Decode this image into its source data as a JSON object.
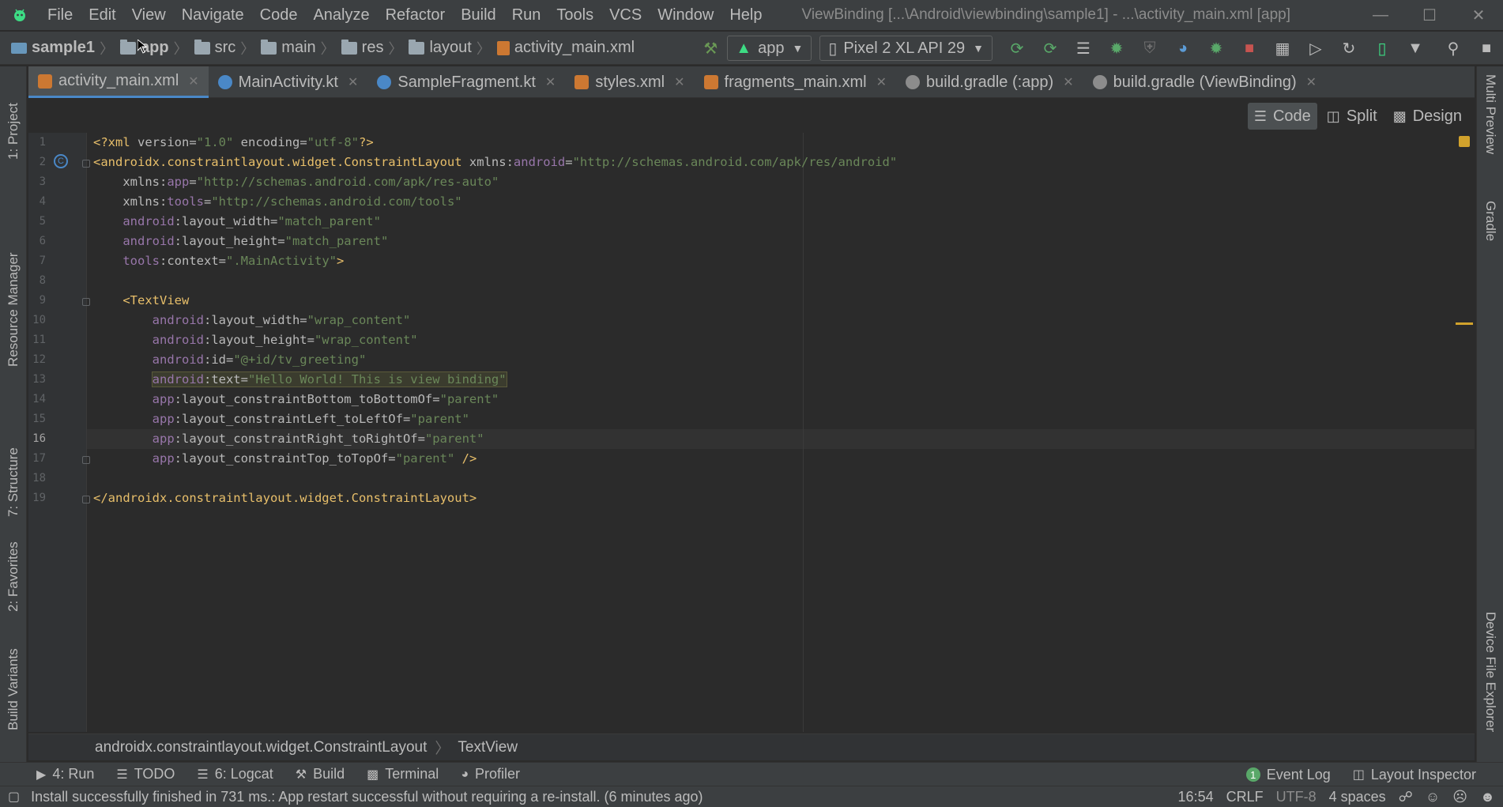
{
  "menubar": {
    "items": [
      "File",
      "Edit",
      "View",
      "Navigate",
      "Code",
      "Analyze",
      "Refactor",
      "Build",
      "Run",
      "Tools",
      "VCS",
      "Window",
      "Help"
    ],
    "window_title": "ViewBinding [...\\Android\\viewbinding\\sample1] - ...\\activity_main.xml [app]"
  },
  "navbar": {
    "crumbs": [
      "sample1",
      "app",
      "src",
      "main",
      "res",
      "layout",
      "activity_main.xml"
    ],
    "run_config": "app",
    "device": "Pixel 2 XL API 29"
  },
  "tabs": [
    {
      "label": "activity_main.xml",
      "active": true
    },
    {
      "label": "MainActivity.kt",
      "active": false
    },
    {
      "label": "SampleFragment.kt",
      "active": false
    },
    {
      "label": "styles.xml",
      "active": false
    },
    {
      "label": "fragments_main.xml",
      "active": false
    },
    {
      "label": "build.gradle (:app)",
      "active": false
    },
    {
      "label": "build.gradle (ViewBinding)",
      "active": false
    }
  ],
  "left_stripe": {
    "project": "1: Project",
    "resource_manager": "Resource Manager",
    "structure": "7: Structure",
    "favorites": "2: Favorites",
    "build_variants": "Build Variants"
  },
  "right_stripe": {
    "multi_preview": "Multi Preview",
    "gradle": "Gradle",
    "device_file_explorer": "Device File Explorer"
  },
  "mode_bar": {
    "code": "Code",
    "split": "Split",
    "design": "Design"
  },
  "editor": {
    "line_numbers": [
      "1",
      "2",
      "3",
      "4",
      "5",
      "6",
      "7",
      "8",
      "9",
      "10",
      "11",
      "12",
      "13",
      "14",
      "15",
      "16",
      "17",
      "18",
      "19"
    ],
    "current_line": 16
  },
  "editor_crumbs": [
    "androidx.constraintlayout.widget.ConstraintLayout",
    "TextView"
  ],
  "bottom_tools": {
    "run": "4: Run",
    "todo": "TODO",
    "logcat": "6: Logcat",
    "build": "Build",
    "terminal": "Terminal",
    "profiler": "Profiler",
    "event_log": "Event Log",
    "event_log_count": "1",
    "layout_inspector": "Layout Inspector"
  },
  "status": {
    "message": "Install successfully finished in 731 ms.: App restart successful without requiring a re-install. (6 minutes ago)",
    "position": "16:54",
    "line_sep": "CRLF",
    "encoding": "UTF-8",
    "indent": "4 spaces"
  }
}
